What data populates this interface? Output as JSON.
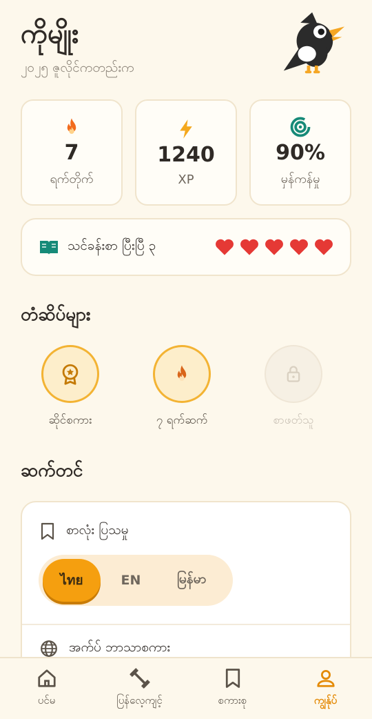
{
  "profile": {
    "name": "ကိုမျိုး",
    "joined": "၂၀၂၅ ဇူလိုင်ကတည်းက"
  },
  "stats": [
    {
      "value": "7",
      "label": "ရက်တိုက်",
      "icon": "flame-icon"
    },
    {
      "value": "1240",
      "label": "XP",
      "icon": "lightning-icon"
    },
    {
      "value": "90%",
      "label": "မှန်ကန်မှု",
      "icon": "target-icon"
    }
  ],
  "lessons": {
    "text": "သင်ခန်းစာ ပြီးပြီ ၃",
    "hearts": 5
  },
  "badges_section": {
    "title": "တံဆိပ်များ",
    "items": [
      {
        "label": "ဆိုင်စကား",
        "unlocked": true,
        "icon": "medal-icon"
      },
      {
        "label": "၇ ရက်ဆက်",
        "unlocked": true,
        "icon": "flame-icon"
      },
      {
        "label": "စာဖတ်သူ",
        "unlocked": false,
        "icon": "lock-icon"
      }
    ]
  },
  "settings_section": {
    "title": "ဆက်တင်",
    "word_display": {
      "label": "စာလုံး ပြသမှု",
      "options": [
        "ไทย",
        "EN",
        "မြန်မာ"
      ],
      "selected": "ไทย"
    },
    "app_language": {
      "label": "အက်ပ် ဘာသာစကား"
    }
  },
  "nav": {
    "items": [
      {
        "label": "ပင်မ",
        "icon": "home-icon",
        "active": false
      },
      {
        "label": "ပြန်လေ့ကျင့်",
        "icon": "dumbbell-icon",
        "active": false
      },
      {
        "label": "စကားစု",
        "icon": "bookmark-icon",
        "active": false
      },
      {
        "label": "ကျွန်ုပ်",
        "icon": "person-icon",
        "active": true
      }
    ]
  },
  "colors": {
    "accent": "#f59f0f",
    "heart": "#e53935",
    "teal": "#168a78",
    "background": "#fdf8ec"
  }
}
